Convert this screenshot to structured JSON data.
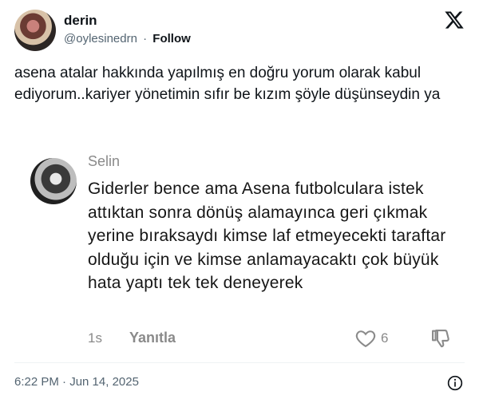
{
  "author": {
    "name": "derin",
    "handle": "@oylesinedrn",
    "separator": "·",
    "follow_label": "Follow"
  },
  "icons": {
    "logo": "x-logo-icon",
    "like": "heart-outline-icon",
    "dislike": "thumbs-down-icon",
    "info": "info-icon"
  },
  "tweet": {
    "text": "asena atalar hakkında yapılmış en doğru yorum olarak kabul ediyorum..kariyer yönetimin sıfır be kızım şöyle düşünseydin ya"
  },
  "embedded_comment": {
    "username": "Selin",
    "text": "Giderler bence ama Asena futbolculara istek attıktan sonra dönüş alamayınca geri çıkmak yerine bıraksaydı kimse laf etmeyecekti taraftar olduğu için ve kimse anlamayacaktı çok büyük hata yaptı tek tek deneyerek",
    "time": "1s",
    "reply_label": "Yanıtla",
    "like_count": "6"
  },
  "footer": {
    "timestamp": "6:22 PM · Jun 14, 2025"
  },
  "colors": {
    "text_primary": "#0f1419",
    "text_secondary": "#536471",
    "comment_meta": "#8a8a8a"
  }
}
